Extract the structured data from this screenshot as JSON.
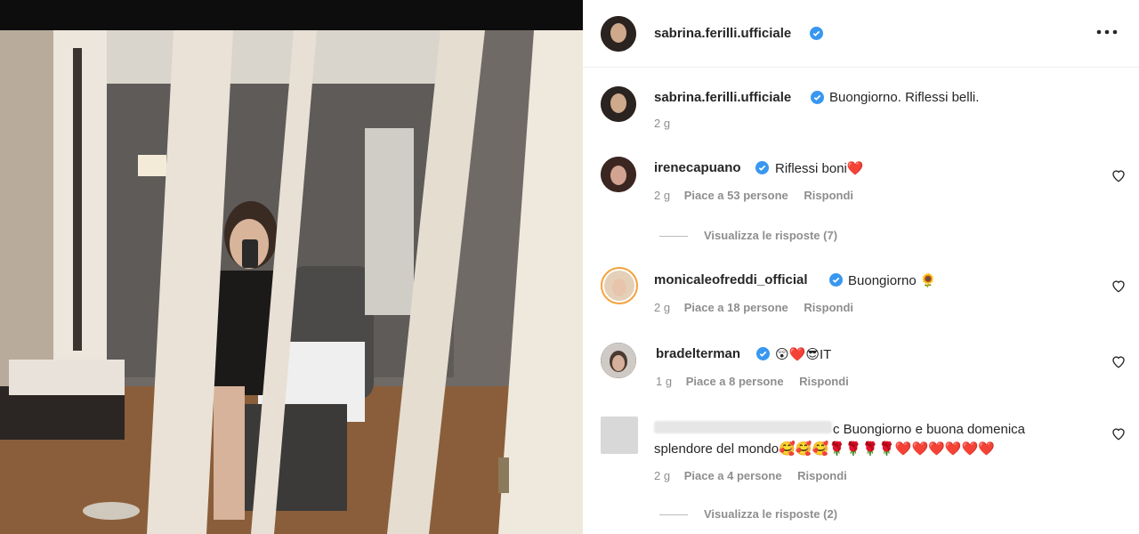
{
  "photo": {
    "description_icon": "mirror-selfie-photo"
  },
  "post": {
    "author": "sabrina.ferilli.ufficiale",
    "caption": "Buongiorno. Riflessi belli.",
    "time": "2 g"
  },
  "comments": [
    {
      "user": "irenecapuano",
      "text": "Riflessi boni",
      "emoji": "❤️",
      "time": "2 g",
      "likes": "Piace a 53 persone",
      "reply": "Rispondi",
      "view_replies": "Visualizza le risposte (7)"
    },
    {
      "user": "monicaleofreddi_official",
      "text": "Buongiorno",
      "emoji": "🌻",
      "time": "2 g",
      "likes": "Piace a 18 persone",
      "reply": "Rispondi"
    },
    {
      "user": "bradelterman",
      "text": "",
      "emoji": "😲❤️😎IT",
      "time": "1 g",
      "likes": "Piace a 8 persone",
      "reply": "Rispondi"
    },
    {
      "user": "c",
      "text": "Buongiorno e buona domenica splendore del mondo",
      "emoji": "🥰🥰🥰🌹🌹🌹🌹❤️❤️❤️❤️❤️❤️",
      "time": "2 g",
      "likes": "Piace a 4 persone",
      "reply": "Rispondi",
      "view_replies": "Visualizza le risposte (2)"
    }
  ],
  "colors": {
    "verified": "#3897f0",
    "muted": "#8e8e8e",
    "text": "#262626"
  }
}
